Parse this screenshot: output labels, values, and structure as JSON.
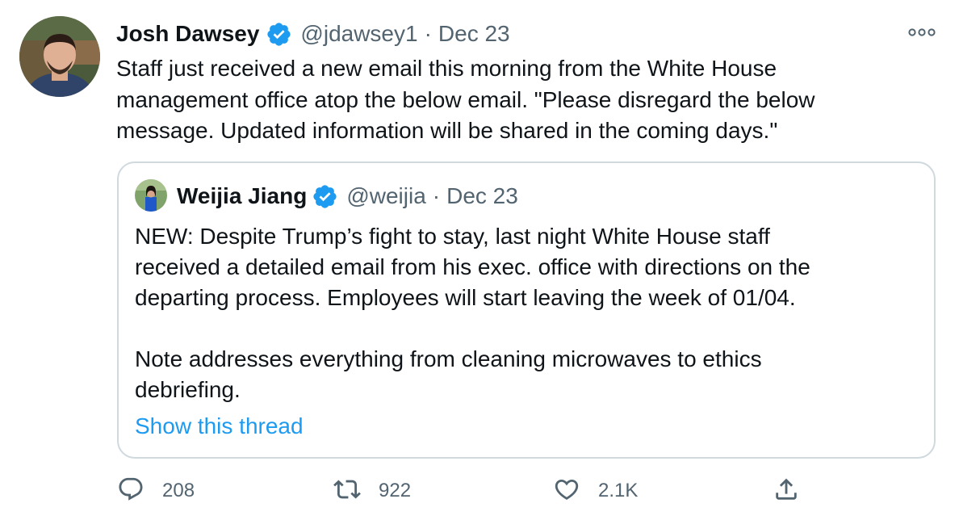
{
  "tweet": {
    "author_name": "Josh Dawsey",
    "handle": "@jdawsey1",
    "separator": "·",
    "date": "Dec 23",
    "text": "Staff just received a new email this morning from the White House\nmanagement office atop the below email. \"Please disregard the below\nmessage. Updated information will be shared in the coming days.\""
  },
  "quoted_tweet": {
    "author_name": "Weijia Jiang",
    "handle": "@weijia",
    "separator": "·",
    "date": "Dec 23",
    "text": "NEW: Despite Trump’s fight to stay, last night White House staff\nreceived a detailed email from his exec. office with directions on the\ndeparting process. Employees will start leaving the week of 01/04.\n\nNote addresses everything from cleaning microwaves to ethics\ndebriefing.",
    "show_thread": "Show this thread"
  },
  "actions": {
    "replies": "208",
    "retweets": "922",
    "likes": "2.1K"
  },
  "icons": {
    "verified": "verified-badge-icon",
    "more": "more-options-icon",
    "reply": "reply-icon",
    "retweet": "retweet-icon",
    "like": "heart-icon",
    "share": "share-icon"
  },
  "colors": {
    "accent": "#1d9bf0",
    "text": "#0f1419",
    "secondary": "#536471",
    "border": "#cfd9de"
  }
}
